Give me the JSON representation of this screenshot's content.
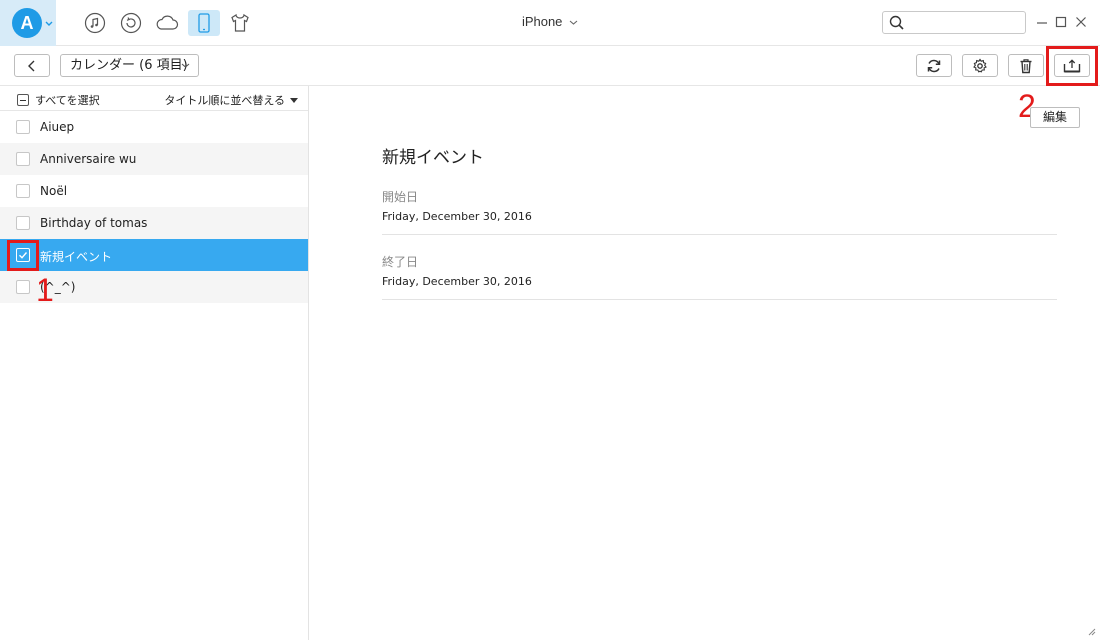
{
  "titlebar": {
    "logo_letter": "A",
    "device_name": "iPhone",
    "search_placeholder": "",
    "icons": [
      "music-icon",
      "history-icon",
      "cloud-icon",
      "phone-icon",
      "tshirt-icon"
    ]
  },
  "toolbar": {
    "category_label": "カレンダー (6 項目)"
  },
  "list": {
    "select_all_label": "すべてを選択",
    "sort_label": "タイトル順に並べ替える",
    "items": [
      {
        "label": "Aiuep",
        "checked": false
      },
      {
        "label": "Anniversaire wu",
        "checked": false
      },
      {
        "label": "Noël",
        "checked": false
      },
      {
        "label": "Birthday of tomas",
        "checked": false
      },
      {
        "label": "新規イベント",
        "checked": true
      },
      {
        "label": "(^_^)",
        "checked": false
      }
    ]
  },
  "annotations": {
    "step1": "1",
    "step2": "2"
  },
  "detail": {
    "edit_label": "編集",
    "title": "新規イベント",
    "start_label": "開始日",
    "start_value": "Friday, December 30, 2016",
    "end_label": "終了日",
    "end_value": "Friday, December 30, 2016"
  },
  "colors": {
    "accent": "#37a9f0",
    "logo": "#1f9be6",
    "annotation_red": "#e31b1b"
  }
}
